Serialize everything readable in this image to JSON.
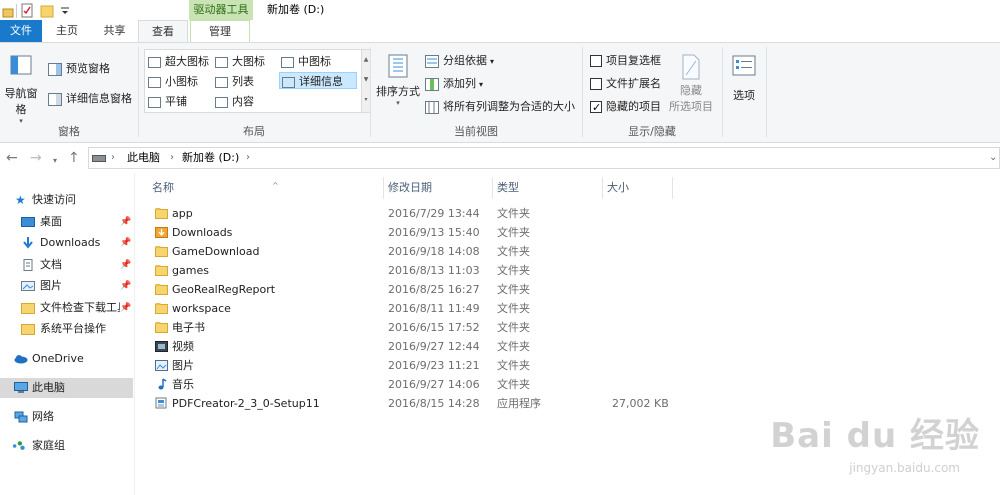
{
  "titlebar": {
    "context_tab_header": "驱动器工具",
    "window_title": "新加卷 (D:)"
  },
  "tabs": {
    "file": "文件",
    "home": "主页",
    "share": "共享",
    "view": "查看",
    "manage": "管理"
  },
  "ribbon": {
    "panes": {
      "nav_pane": "导航窗格",
      "preview_pane": "预览窗格",
      "details_pane": "详细信息窗格",
      "group": "窗格"
    },
    "layout": {
      "items": [
        "超大图标",
        "大图标",
        "中图标",
        "小图标",
        "列表",
        "详细信息",
        "平铺",
        "内容"
      ],
      "selected": "详细信息",
      "group": "布局"
    },
    "current_view": {
      "sort_by": "排序方式",
      "group_by": "分组依据",
      "add_column": "添加列",
      "fit_columns": "将所有列调整为合适的大小",
      "group": "当前视图"
    },
    "show_hide": {
      "item_checkboxes": "项目复选框",
      "file_extensions": "文件扩展名",
      "hidden_items": "隐藏的项目",
      "hide_selected_line1": "隐藏",
      "hide_selected_line2": "所选项目",
      "group": "显示/隐藏",
      "checked": {
        "item_checkboxes": false,
        "file_extensions": false,
        "hidden_items": true
      }
    },
    "options": "选项"
  },
  "address": {
    "crumbs": [
      "此电脑",
      "新加卷 (D:)"
    ]
  },
  "navpane": {
    "quick_access": "快速访问",
    "quick_items": [
      {
        "label": "桌面",
        "icon": "desktop-icon"
      },
      {
        "label": "Downloads",
        "icon": "download-arrow-icon"
      },
      {
        "label": "文档",
        "icon": "document-icon"
      },
      {
        "label": "图片",
        "icon": "picture-icon"
      },
      {
        "label": "文件检查下载工具",
        "icon": "folder-icon"
      },
      {
        "label": "系统平台操作",
        "icon": "folder-icon"
      }
    ],
    "onedrive": "OneDrive",
    "this_pc": "此电脑",
    "network": "网络",
    "homegroup": "家庭组"
  },
  "list": {
    "columns": [
      "名称",
      "修改日期",
      "类型",
      "大小"
    ],
    "rows": [
      {
        "name": "app",
        "date": "2016/7/29 13:44",
        "type": "文件夹",
        "size": "",
        "icon": "folder-icon"
      },
      {
        "name": "Downloads",
        "date": "2016/9/13 15:40",
        "type": "文件夹",
        "size": "",
        "icon": "download-folder-icon"
      },
      {
        "name": "GameDownload",
        "date": "2016/9/18 14:08",
        "type": "文件夹",
        "size": "",
        "icon": "folder-icon"
      },
      {
        "name": "games",
        "date": "2016/8/13 11:03",
        "type": "文件夹",
        "size": "",
        "icon": "folder-icon"
      },
      {
        "name": "GeoRealRegReport",
        "date": "2016/8/25 16:27",
        "type": "文件夹",
        "size": "",
        "icon": "folder-icon"
      },
      {
        "name": "workspace",
        "date": "2016/8/11 11:49",
        "type": "文件夹",
        "size": "",
        "icon": "folder-icon"
      },
      {
        "name": "电子书",
        "date": "2016/6/15 17:52",
        "type": "文件夹",
        "size": "",
        "icon": "folder-icon"
      },
      {
        "name": "视频",
        "date": "2016/9/27 12:44",
        "type": "文件夹",
        "size": "",
        "icon": "video-folder-icon"
      },
      {
        "name": "图片",
        "date": "2016/9/23 11:21",
        "type": "文件夹",
        "size": "",
        "icon": "picture-folder-icon"
      },
      {
        "name": "音乐",
        "date": "2016/9/27 14:06",
        "type": "文件夹",
        "size": "",
        "icon": "music-note-icon"
      },
      {
        "name": "PDFCreator-2_3_0-Setup11",
        "date": "2016/8/15 14:28",
        "type": "应用程序",
        "size": "27,002 KB",
        "icon": "installer-icon"
      }
    ]
  },
  "watermark": {
    "logo": "Bai du 经验",
    "url": "jingyan.baidu.com"
  }
}
